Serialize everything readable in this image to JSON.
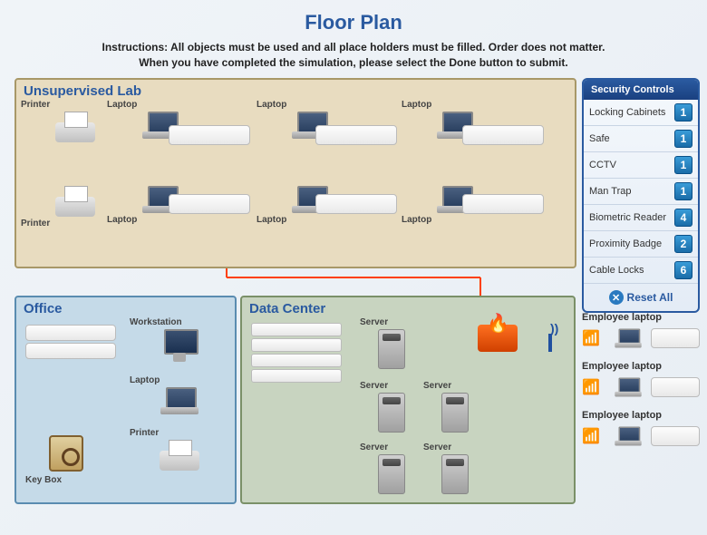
{
  "title": "Floor Plan",
  "instructions_line1": "Instructions: All objects must be used and all place holders must be filled. Order does not matter.",
  "instructions_line2": "When you have completed the simulation, please select the Done button to submit.",
  "zones": {
    "unsupervised_lab": {
      "title": "Unsupervised Lab"
    },
    "office": {
      "title": "Office"
    },
    "data_center": {
      "title": "Data Center"
    }
  },
  "lab_devices_top": [
    {
      "label": "Printer",
      "type": "printer"
    },
    {
      "label": "Laptop",
      "type": "laptop"
    },
    {
      "label": "Laptop",
      "type": "laptop"
    },
    {
      "label": "Laptop",
      "type": "laptop"
    }
  ],
  "lab_devices_bottom": [
    {
      "label": "Printer",
      "type": "printer"
    },
    {
      "label": "Laptop",
      "type": "laptop"
    },
    {
      "label": "Laptop",
      "type": "laptop"
    },
    {
      "label": "Laptop",
      "type": "laptop"
    }
  ],
  "office_devices": {
    "workstation": "Workstation",
    "laptop": "Laptop",
    "printer": "Printer",
    "keybox": "Key Box"
  },
  "data_center_devices": {
    "server1": "Server",
    "server2": "Server",
    "server3": "Server",
    "server4": "Server",
    "server5": "Server"
  },
  "security_panel": {
    "header": "Security Controls",
    "items": [
      {
        "label": "Locking Cabinets",
        "count": "1"
      },
      {
        "label": "Safe",
        "count": "1"
      },
      {
        "label": "CCTV",
        "count": "1"
      },
      {
        "label": "Man Trap",
        "count": "1"
      },
      {
        "label": "Biometric Reader",
        "count": "4"
      },
      {
        "label": "Proximity Badge",
        "count": "2"
      },
      {
        "label": "Cable Locks",
        "count": "6"
      }
    ],
    "reset_label": "Reset  All"
  },
  "employee_laptops": [
    {
      "label": "Employee laptop"
    },
    {
      "label": "Employee laptop"
    },
    {
      "label": "Employee laptop"
    }
  ]
}
